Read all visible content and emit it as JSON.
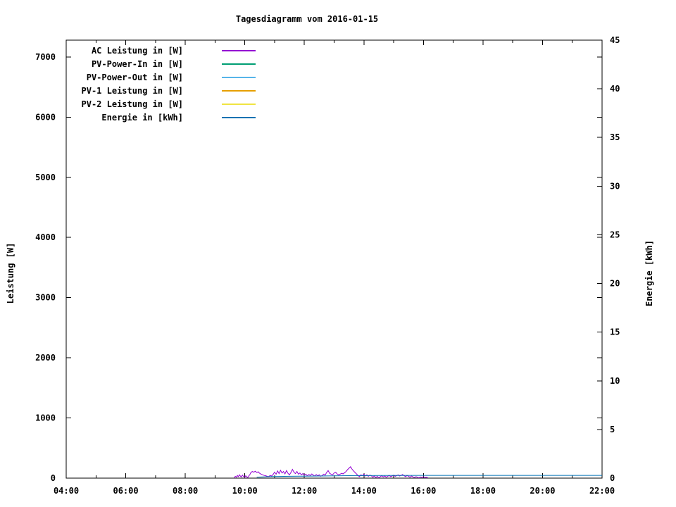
{
  "chart_data": {
    "type": "line",
    "title": "Tagesdiagramm vom 2016-01-15",
    "ylabel": "Leistung [W]",
    "y2label": "Energie [kWh]",
    "xlim_hours": [
      4,
      22
    ],
    "ylim_left": [
      0,
      7280
    ],
    "ylim_right": [
      0,
      45
    ],
    "grid": false,
    "legend_position": "top-left-inside",
    "axis_color": "#000000",
    "x_major_ticks": [
      {
        "h": 4,
        "label": "04:00"
      },
      {
        "h": 6,
        "label": "06:00"
      },
      {
        "h": 8,
        "label": "08:00"
      },
      {
        "h": 10,
        "label": "10:00"
      },
      {
        "h": 12,
        "label": "12:00"
      },
      {
        "h": 14,
        "label": "14:00"
      },
      {
        "h": 16,
        "label": "16:00"
      },
      {
        "h": 18,
        "label": "18:00"
      },
      {
        "h": 20,
        "label": "20:00"
      },
      {
        "h": 22,
        "label": "22:00"
      }
    ],
    "x_minor_hours": [
      5,
      7,
      9,
      11,
      13,
      15,
      17,
      19,
      21
    ],
    "y_left_ticks": [
      0,
      1000,
      2000,
      3000,
      4000,
      5000,
      6000,
      7000
    ],
    "y_right_ticks": [
      0,
      5,
      10,
      15,
      20,
      25,
      30,
      35,
      40,
      45
    ],
    "legend": [
      {
        "label": "AC Leistung in [W]",
        "color": "#9400d3"
      },
      {
        "label": "PV-Power-In in [W]",
        "color": "#009e73"
      },
      {
        "label": "PV-Power-Out in [W]",
        "color": "#56b4e9"
      },
      {
        "label": "PV-1 Leistung in [W]",
        "color": "#e69f00"
      },
      {
        "label": "PV-2 Leistung in [W]",
        "color": "#f0e442"
      },
      {
        "label": "Energie in [kWh]",
        "color": "#0072b2"
      }
    ],
    "series": [
      {
        "name": "AC Leistung in [W]",
        "color": "#9400d3",
        "axis": "left",
        "points": [
          [
            9.65,
            5
          ],
          [
            9.68,
            30
          ],
          [
            9.72,
            15
          ],
          [
            9.75,
            45
          ],
          [
            9.78,
            25
          ],
          [
            9.82,
            55
          ],
          [
            9.85,
            35
          ],
          [
            9.88,
            20
          ],
          [
            9.92,
            50
          ],
          [
            9.95,
            30
          ],
          [
            10.0,
            15
          ],
          [
            10.03,
            40
          ],
          [
            10.07,
            20
          ],
          [
            10.1,
            10
          ],
          [
            10.13,
            35
          ],
          [
            10.17,
            60
          ],
          [
            10.2,
            90
          ],
          [
            10.25,
            110
          ],
          [
            10.3,
            100
          ],
          [
            10.35,
            115
          ],
          [
            10.4,
            95
          ],
          [
            10.45,
            105
          ],
          [
            10.5,
            80
          ],
          [
            10.55,
            65
          ],
          [
            10.6,
            55
          ],
          [
            10.65,
            45
          ],
          [
            10.7,
            40
          ],
          [
            10.75,
            30
          ],
          [
            10.8,
            25
          ],
          [
            10.85,
            45
          ],
          [
            10.9,
            35
          ],
          [
            10.95,
            60
          ],
          [
            11.0,
            100
          ],
          [
            11.05,
            65
          ],
          [
            11.1,
            120
          ],
          [
            11.15,
            75
          ],
          [
            11.2,
            130
          ],
          [
            11.25,
            85
          ],
          [
            11.3,
            110
          ],
          [
            11.35,
            70
          ],
          [
            11.4,
            125
          ],
          [
            11.45,
            80
          ],
          [
            11.5,
            55
          ],
          [
            11.55,
            95
          ],
          [
            11.6,
            145
          ],
          [
            11.65,
            100
          ],
          [
            11.7,
            75
          ],
          [
            11.75,
            110
          ],
          [
            11.8,
            65
          ],
          [
            11.85,
            85
          ],
          [
            11.9,
            55
          ],
          [
            11.95,
            75
          ],
          [
            12.0,
            50
          ],
          [
            12.05,
            65
          ],
          [
            12.1,
            40
          ],
          [
            12.15,
            60
          ],
          [
            12.2,
            45
          ],
          [
            12.25,
            70
          ],
          [
            12.3,
            50
          ],
          [
            12.35,
            35
          ],
          [
            12.4,
            60
          ],
          [
            12.45,
            40
          ],
          [
            12.5,
            55
          ],
          [
            12.55,
            30
          ],
          [
            12.6,
            45
          ],
          [
            12.65,
            65
          ],
          [
            12.7,
            50
          ],
          [
            12.75,
            95
          ],
          [
            12.8,
            125
          ],
          [
            12.85,
            80
          ],
          [
            12.9,
            65
          ],
          [
            12.95,
            55
          ],
          [
            13.0,
            85
          ],
          [
            13.05,
            100
          ],
          [
            13.1,
            70
          ],
          [
            13.15,
            55
          ],
          [
            13.2,
            65
          ],
          [
            13.25,
            80
          ],
          [
            13.3,
            70
          ],
          [
            13.35,
            90
          ],
          [
            13.4,
            110
          ],
          [
            13.45,
            140
          ],
          [
            13.5,
            165
          ],
          [
            13.55,
            190
          ],
          [
            13.6,
            150
          ],
          [
            13.65,
            120
          ],
          [
            13.7,
            95
          ],
          [
            13.75,
            70
          ],
          [
            13.8,
            45
          ],
          [
            13.85,
            25
          ],
          [
            13.9,
            55
          ],
          [
            13.95,
            40
          ],
          [
            14.0,
            65
          ],
          [
            14.05,
            35
          ],
          [
            14.1,
            55
          ],
          [
            14.15,
            30
          ],
          [
            14.2,
            50
          ],
          [
            14.25,
            40
          ],
          [
            14.3,
            15
          ],
          [
            14.35,
            35
          ],
          [
            14.4,
            10
          ],
          [
            14.45,
            30
          ],
          [
            14.5,
            5
          ],
          [
            14.55,
            25
          ],
          [
            14.6,
            40
          ],
          [
            14.65,
            20
          ],
          [
            14.7,
            35
          ],
          [
            14.75,
            15
          ],
          [
            14.8,
            30
          ],
          [
            14.85,
            45
          ],
          [
            14.9,
            25
          ],
          [
            14.95,
            35
          ],
          [
            15.0,
            50
          ],
          [
            15.05,
            30
          ],
          [
            15.1,
            40
          ],
          [
            15.15,
            55
          ],
          [
            15.2,
            35
          ],
          [
            15.25,
            45
          ],
          [
            15.3,
            60
          ],
          [
            15.35,
            40
          ],
          [
            15.4,
            25
          ],
          [
            15.45,
            45
          ],
          [
            15.5,
            30
          ],
          [
            15.55,
            15
          ],
          [
            15.6,
            35
          ],
          [
            15.65,
            20
          ],
          [
            15.7,
            10
          ],
          [
            15.75,
            25
          ],
          [
            15.8,
            15
          ],
          [
            15.85,
            5
          ],
          [
            15.9,
            20
          ],
          [
            15.95,
            10
          ],
          [
            16.0,
            25
          ],
          [
            16.05,
            10
          ],
          [
            16.1,
            15
          ],
          [
            16.15,
            5
          ]
        ]
      },
      {
        "name": "PV-Power-In in [W]",
        "color": "#009e73",
        "axis": "left",
        "points": []
      },
      {
        "name": "PV-Power-Out in [W]",
        "color": "#56b4e9",
        "axis": "left",
        "points": []
      },
      {
        "name": "PV-1 Leistung in [W]",
        "color": "#e69f00",
        "axis": "left",
        "points": []
      },
      {
        "name": "PV-2 Leistung in [W]",
        "color": "#f0e442",
        "axis": "left",
        "points": []
      },
      {
        "name": "Energie in [kWh]",
        "color": "#0072b2",
        "axis": "right",
        "points": [
          [
            10.4,
            0.1
          ],
          [
            10.8,
            0.15
          ],
          [
            11.5,
            0.19
          ],
          [
            12.5,
            0.22
          ],
          [
            13.5,
            0.25
          ],
          [
            14.5,
            0.27
          ],
          [
            16.0,
            0.28
          ],
          [
            22.0,
            0.28
          ]
        ]
      }
    ]
  }
}
